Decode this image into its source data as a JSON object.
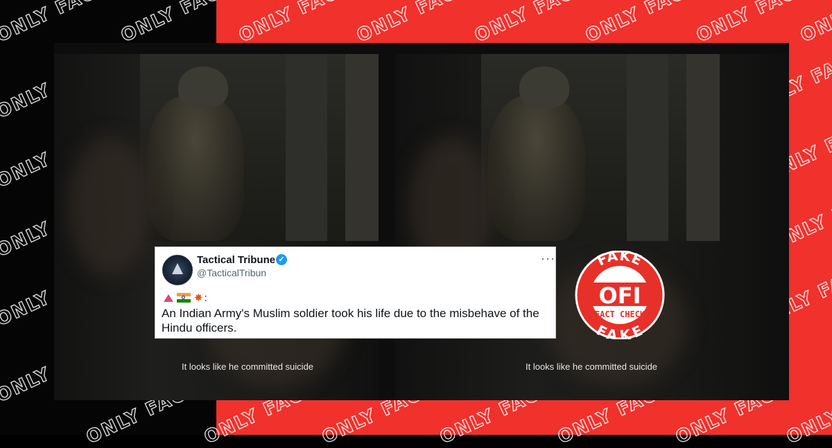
{
  "watermark": "ONLY FACT",
  "tweet": {
    "name": "Tactical Tribune",
    "handle": "@TacticalTribun",
    "more": "···",
    "emoji_suffix": ":",
    "text": "An Indian Army's Muslim soldier took his life due to the misbehave of the Hindu officers."
  },
  "video": {
    "subtitle_left": "It looks like he committed suicide",
    "subtitle_right": "It looks like he committed suicide"
  },
  "badge": {
    "top": "FAKE",
    "logo": "OFI",
    "middle": "FACT CHECK",
    "bottom": "FAKE"
  },
  "colors": {
    "accent_red": "#f0312c",
    "verified_blue": "#1d9bf0"
  }
}
